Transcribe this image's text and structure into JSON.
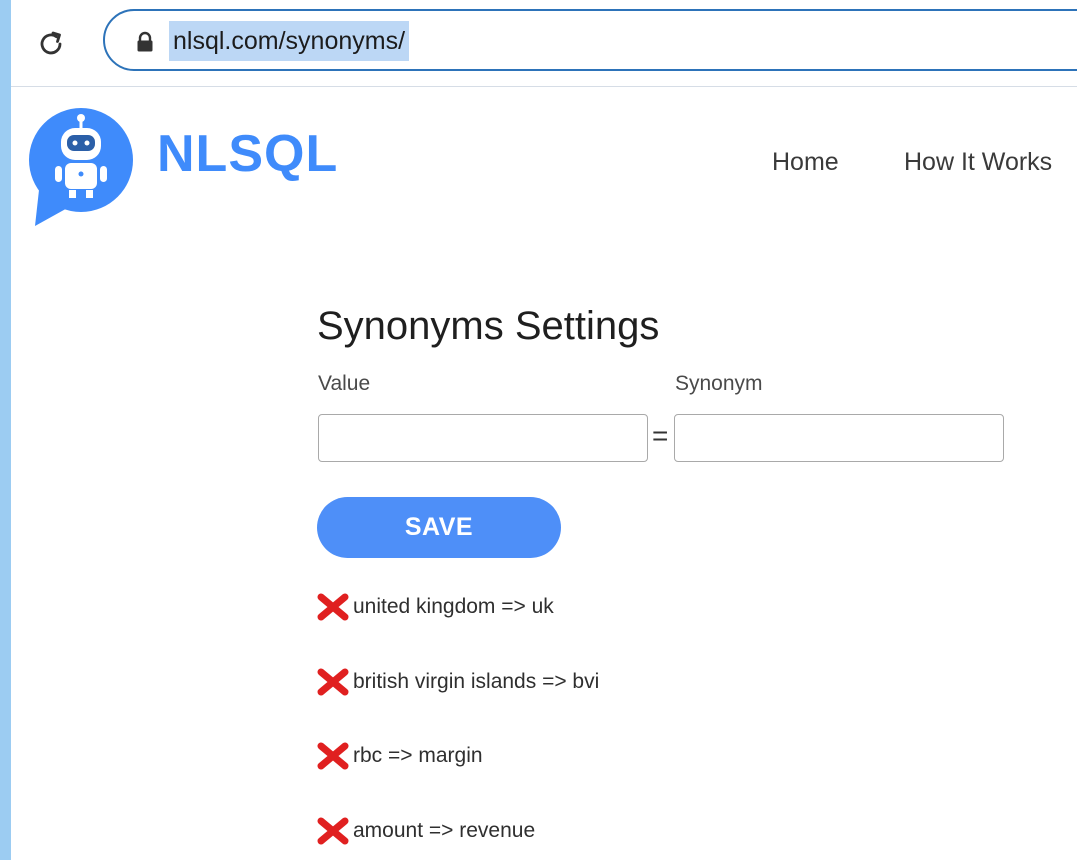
{
  "browser": {
    "url": "nlsql.com/synonyms/"
  },
  "site": {
    "brand": "NLSQL",
    "brand_color": "#3f8bfb",
    "nav": [
      "Home",
      "How It Works"
    ]
  },
  "page": {
    "title": "Synonyms Settings",
    "value_label": "Value",
    "synonym_label": "Synonym",
    "value_input": "",
    "synonym_input": "",
    "equals": "=",
    "save_label": "SAVE",
    "save_color": "#4e8ff8"
  },
  "synonyms": [
    "united kingdom => uk",
    "british virgin islands => bvi",
    "rbc => margin",
    "amount => revenue"
  ],
  "icons": {
    "reload": "reload-icon",
    "lock": "lock-icon",
    "logo": "robot-chat-logo",
    "delete": "red-x-delete-icon"
  },
  "delete_color": "#e02020"
}
